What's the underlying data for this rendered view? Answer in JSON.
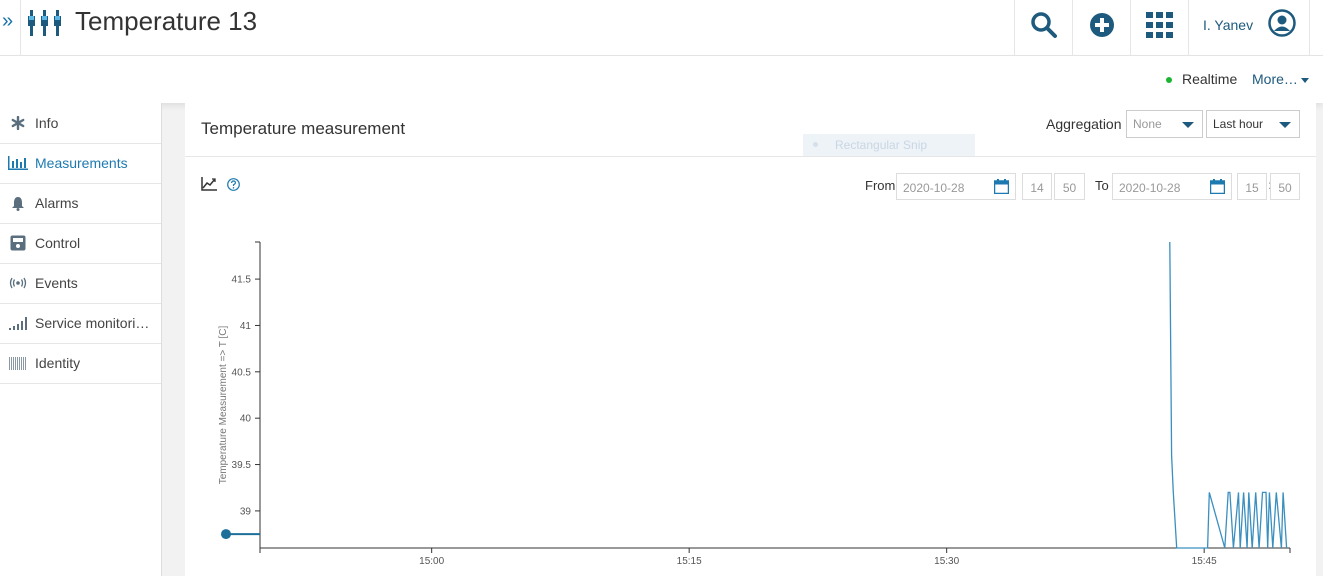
{
  "header": {
    "expand_glyph": "»",
    "title": "Temperature 13",
    "device_icon": "device-icon",
    "search_icon": "search-icon",
    "add_icon": "plus-circle-icon",
    "apps_icon": "grid-icon",
    "user_name": "I. Yanev",
    "user_icon": "user-icon"
  },
  "subheader": {
    "realtime_label": "Realtime",
    "more_label": "More…",
    "realtime_color": "#1bb532"
  },
  "sidebar": {
    "items": [
      {
        "label": "Info",
        "icon": "asterisk-icon"
      },
      {
        "label": "Measurements",
        "icon": "bar-chart-icon"
      },
      {
        "label": "Alarms",
        "icon": "bell-icon"
      },
      {
        "label": "Control",
        "icon": "control-icon"
      },
      {
        "label": "Events",
        "icon": "broadcast-icon"
      },
      {
        "label": "Service monitori…",
        "icon": "signal-icon"
      },
      {
        "label": "Identity",
        "icon": "barcode-icon"
      }
    ],
    "active_index": 1,
    "accent": "#1d7ab0"
  },
  "card": {
    "title": "Temperature measurement",
    "aggregation_label": "Aggregation",
    "aggregation_value": "None",
    "range_value": "Last hour",
    "snip_label": "Rectangular Snip",
    "chart_icon": "line-chart-icon",
    "help_icon": "help-icon",
    "from_label": "From",
    "from_date": "2020-10-28",
    "from_hour": "14",
    "from_minute": "50",
    "to_label": "To",
    "to_date": "2020-10-28",
    "to_hour": "15",
    "to_minute": "50",
    "calendar_icon": "calendar-icon"
  },
  "chart_data": {
    "type": "line",
    "title": "",
    "ylabel": "Temperature Measurement => T [C]",
    "xlabel": "",
    "ylim": [
      38.6,
      41.9
    ],
    "xlim": [
      "14:50",
      "15:50"
    ],
    "x_ticks": [
      "15:00",
      "15:15",
      "15:30",
      "15:45"
    ],
    "y_ticks": [
      "39",
      "39.5",
      "40",
      "40.5",
      "41",
      "41.5"
    ],
    "grid": false,
    "series_color": "#3a8fbf",
    "series": [
      {
        "x": [
          "15:43",
          "15:43.1",
          "15:43.2",
          "15:43.4",
          "15:43.5",
          "15:45.2",
          "15:45.3",
          "15:46.2",
          "15:46.4",
          "15:46.5",
          "15:46.7",
          "15:47.0",
          "15:47.1",
          "15:47.3",
          "15:47.5",
          "15:47.6",
          "15:47.8",
          "15:48.0",
          "15:48.2",
          "15:48.4",
          "15:48.6",
          "15:48.7",
          "15:48.8",
          "15:49.0",
          "15:49.2",
          "15:49.5",
          "15:49.6",
          "15:49.8"
        ],
        "values": [
          41.9,
          39.6,
          39.2,
          38.6,
          38.6,
          38.6,
          39.2,
          38.6,
          39.2,
          39.2,
          38.6,
          39.2,
          38.6,
          39.2,
          38.6,
          39.2,
          38.6,
          39.2,
          38.6,
          39.2,
          39.2,
          38.6,
          39.2,
          38.6,
          39.2,
          38.6,
          39.2,
          38.6
        ]
      }
    ],
    "marker": {
      "value": 38.75,
      "label": ""
    }
  }
}
